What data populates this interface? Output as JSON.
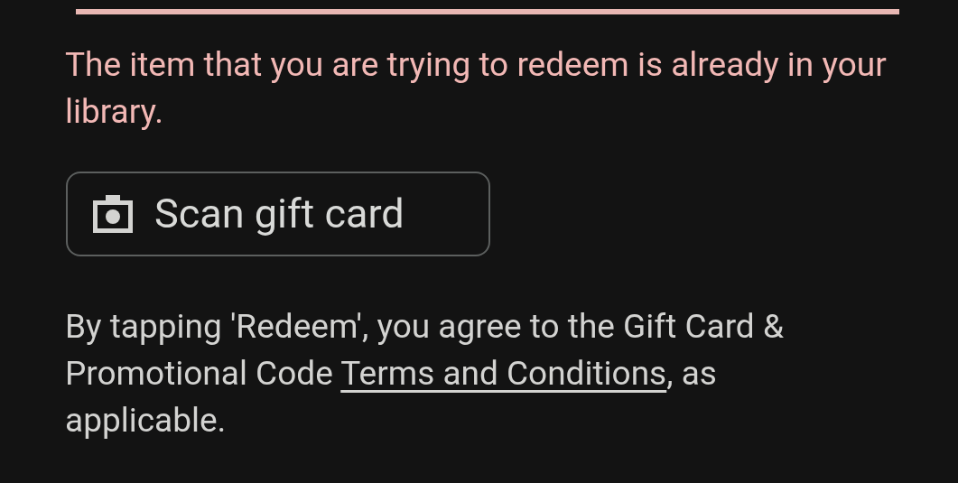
{
  "code_field": {
    "error": true
  },
  "error_message": "The item that you are trying to redeem is already in your library.",
  "scan_button": {
    "label": "Scan gift card"
  },
  "terms": {
    "before": "By tapping 'Redeem', you agree to the Gift Card & Promotional Code ",
    "link": "Terms and Conditions",
    "after": ", as applicable."
  }
}
